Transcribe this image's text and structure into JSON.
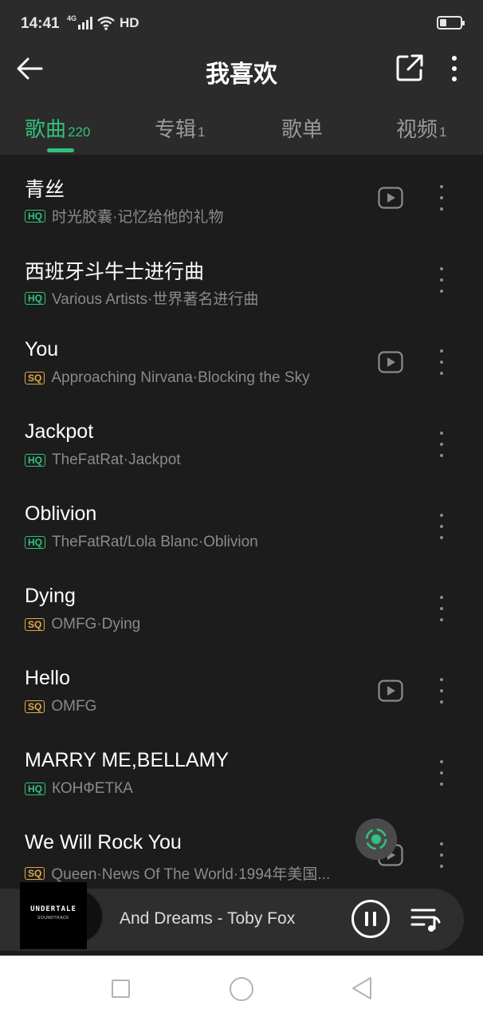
{
  "status_bar": {
    "time": "14:41",
    "network": "4G",
    "hd_label": "HD"
  },
  "header": {
    "title": "我喜欢",
    "back_icon": "arrow-left-icon",
    "share_icon": "share-external-icon",
    "more_icon": "more-vertical-icon"
  },
  "tabs": [
    {
      "label": "歌曲",
      "count": "220",
      "active": true
    },
    {
      "label": "专辑",
      "count": "1",
      "active": false
    },
    {
      "label": "歌单",
      "count": "",
      "active": false
    },
    {
      "label": "视频",
      "count": "1",
      "active": false
    }
  ],
  "songs": [
    {
      "title": "青丝",
      "quality": "HQ",
      "artist": "时光胶囊·记忆给他的礼物",
      "has_mv": true
    },
    {
      "title": "西班牙斗牛士进行曲",
      "quality": "HQ",
      "artist": "Various Artists·世界著名进行曲",
      "has_mv": false
    },
    {
      "title": "You",
      "quality": "SQ",
      "artist": "Approaching Nirvana·Blocking the Sky",
      "has_mv": true
    },
    {
      "title": "Jackpot",
      "quality": "HQ",
      "artist": "TheFatRat·Jackpot",
      "has_mv": false
    },
    {
      "title": "Oblivion",
      "quality": "HQ",
      "artist": "TheFatRat/Lola Blanc·Oblivion",
      "has_mv": false
    },
    {
      "title": "Dying",
      "quality": "SQ",
      "artist": "OMFG·Dying",
      "has_mv": false
    },
    {
      "title": "Hello",
      "quality": "SQ",
      "artist": "OMFG",
      "has_mv": true
    },
    {
      "title": "MARRY ME,BELLAMY",
      "quality": "HQ",
      "artist": "КОНФЕТКА",
      "has_mv": false
    },
    {
      "title": "We Will Rock You",
      "quality": "SQ",
      "artist": "Queen·News Of The World·1994年美国...",
      "has_mv": true
    }
  ],
  "mini_player": {
    "cover_title": "UNDERTALE",
    "cover_subtitle": "SOUNDTRACK",
    "now_playing": "And Dreams - Toby Fox",
    "pause_icon": "pause-icon",
    "playlist_icon": "playlist-icon"
  },
  "colors": {
    "accent": "#31c27c",
    "sq": "#e0a94a",
    "background": "#1c1c1c",
    "header": "#2b2b2b"
  }
}
